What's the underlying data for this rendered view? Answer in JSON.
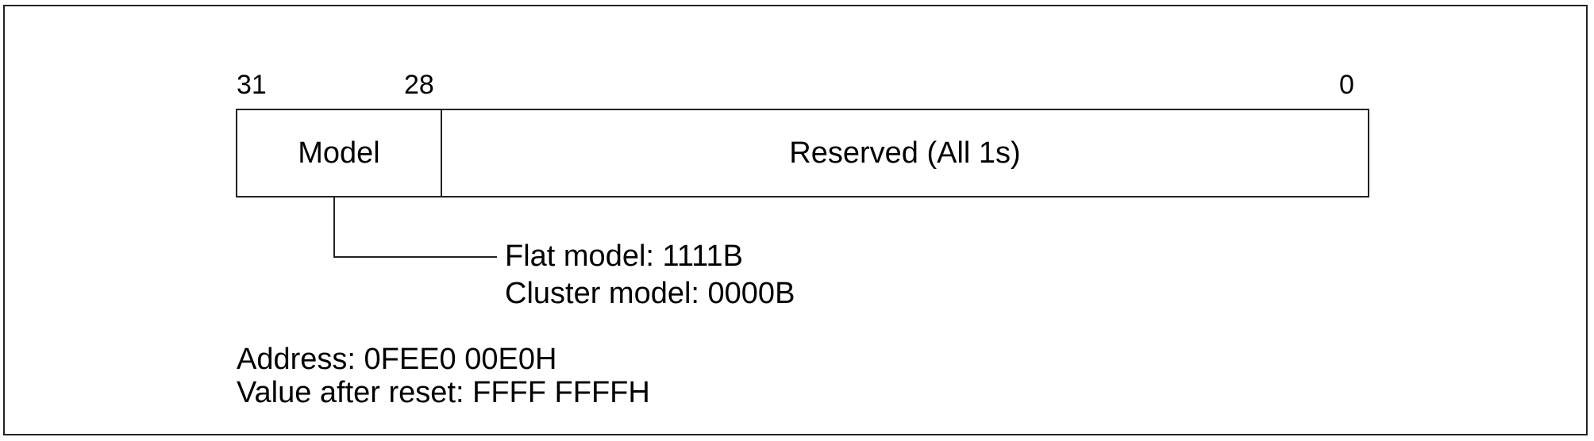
{
  "bit_positions": {
    "high": "31",
    "model_low": "28",
    "low": "0"
  },
  "fields": [
    {
      "label": "Model"
    },
    {
      "label": "Reserved (All 1s)"
    }
  ],
  "model_callout": {
    "flat": "Flat model: 1111B",
    "cluster": "Cluster model: 0000B"
  },
  "register_info": {
    "address": "Address: 0FEE0 00E0H",
    "reset_value": "Value after reset: FFFF FFFFH"
  }
}
